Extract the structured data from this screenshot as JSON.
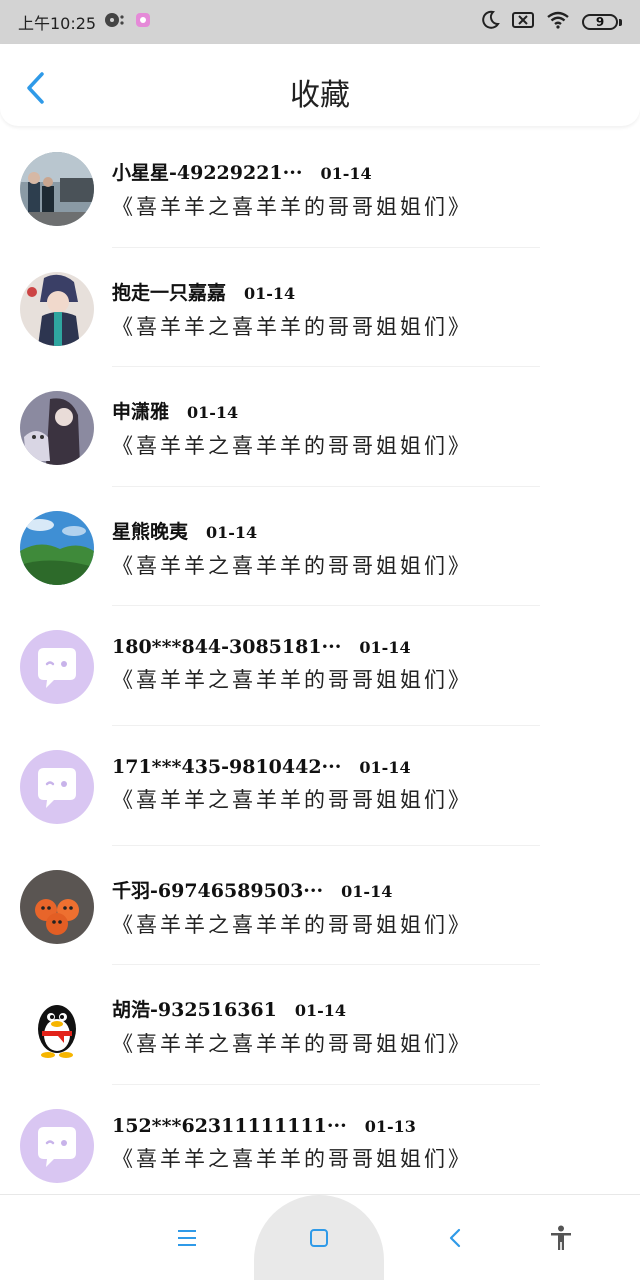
{
  "status_bar": {
    "time": "上午10:25",
    "battery_level": "9"
  },
  "header": {
    "title": "收藏"
  },
  "favorites": [
    {
      "name": "小星星-49229221···",
      "date": "01-14",
      "preview": "《喜羊羊之喜羊羊的哥哥姐姐们》",
      "avatar": "photo-people-car"
    },
    {
      "name": "抱走一只嘉嘉",
      "date": "01-14",
      "preview": "《喜羊羊之喜羊羊的哥哥姐姐们》",
      "avatar": "anime-character"
    },
    {
      "name": "申潇雅",
      "date": "01-14",
      "preview": "《喜羊羊之喜羊羊的哥哥姐姐们》",
      "avatar": "photo-girl-dog"
    },
    {
      "name": "星熊晚夷",
      "date": "01-14",
      "preview": "《喜羊羊之喜羊羊的哥哥姐姐们》",
      "avatar": "landscape-hills"
    },
    {
      "name": "180***844-3085181···",
      "date": "01-14",
      "preview": "《喜羊羊之喜羊羊的哥哥姐姐们》",
      "avatar": "default-chat-bubble"
    },
    {
      "name": "171***435-9810442···",
      "date": "01-14",
      "preview": "《喜羊羊之喜羊羊的哥哥姐姐们》",
      "avatar": "default-chat-bubble"
    },
    {
      "name": "千羽-69746589503···",
      "date": "01-14",
      "preview": "《喜羊羊之喜羊羊的哥哥姐姐们》",
      "avatar": "orange-animals"
    },
    {
      "name": "胡浩-932516361",
      "date": "01-14",
      "preview": "《喜羊羊之喜羊羊的哥哥姐姐们》",
      "avatar": "qq-penguin"
    },
    {
      "name": "152***62311111111···",
      "date": "01-13",
      "preview": "《喜羊羊之喜羊羊的哥哥姐姐们》",
      "avatar": "default-chat-bubble"
    }
  ],
  "colors": {
    "accent": "#2f9ae8",
    "status_bar_bg": "#d3d3d3",
    "default_avatar_bg": "#d9c6f2"
  }
}
